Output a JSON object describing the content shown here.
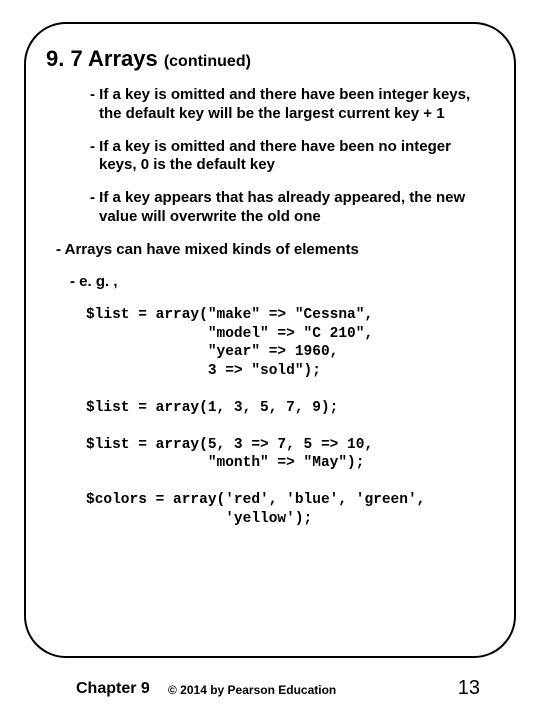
{
  "title_main": "9. 7 Arrays ",
  "title_sub": "(continued)",
  "bullets": {
    "b1": "- If a key is omitted and there have been integer keys, the default key will be the largest current key + 1",
    "b2": "- If a key is omitted and there have been no integer keys, 0 is the default key",
    "b3": "- If a key appears that has already appeared, the new value will overwrite the old one",
    "b4": "- Arrays can have mixed kinds of elements",
    "b5": "- e. g. ,"
  },
  "code": "$list = array(\"make\" => \"Cessna\",\n              \"model\" => \"C 210\",\n              \"year\" => 1960,\n              3 => \"sold\");\n\n$list = array(1, 3, 5, 7, 9);\n\n$list = array(5, 3 => 7, 5 => 10,\n              \"month\" => \"May\");\n\n$colors = array('red', 'blue', 'green',\n                'yellow');",
  "footer": {
    "chapter": "Chapter 9",
    "copyright": "© 2014 by Pearson Education",
    "page": "13"
  }
}
